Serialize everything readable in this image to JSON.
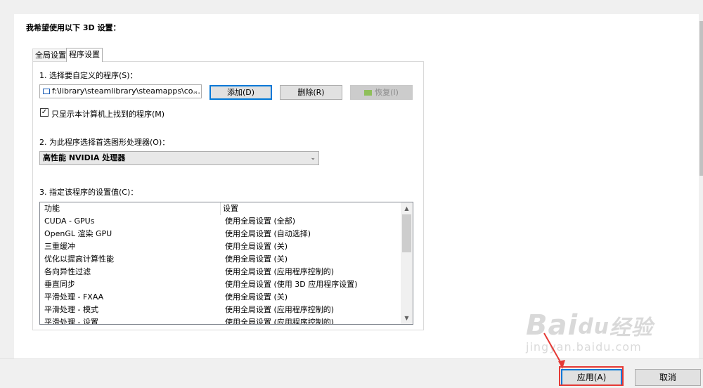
{
  "heading": "我希望使用以下 3D 设置：",
  "tabs": [
    {
      "label": "全局设置"
    },
    {
      "label": "程序设置"
    }
  ],
  "section1": {
    "label": "1. 选择要自定义的程序(S)：",
    "program_value": "f:\\library\\steamlibrary\\steamapps\\co...",
    "add_label": "添加(D)",
    "delete_label": "删除(R)",
    "restore_label": "恢复(I)",
    "checkbox_label": "只显示本计算机上找到的程序(M)",
    "checkbox_checked": true
  },
  "section2": {
    "label": "2. 为此程序选择首选图形处理器(O)：",
    "gpu_value": "高性能 NVIDIA 处理器"
  },
  "section3": {
    "label": "3. 指定该程序的设置值(C)：",
    "col_feature": "功能",
    "col_setting": "设置",
    "rows": [
      {
        "feature": "CUDA - GPUs",
        "setting": "使用全局设置 (全部)"
      },
      {
        "feature": "OpenGL 渲染 GPU",
        "setting": "使用全局设置 (自动选择)"
      },
      {
        "feature": "三重缓冲",
        "setting": "使用全局设置 (关)"
      },
      {
        "feature": "优化以提高计算性能",
        "setting": "使用全局设置 (关)"
      },
      {
        "feature": "各向异性过滤",
        "setting": "使用全局设置 (应用程序控制的)"
      },
      {
        "feature": "垂直同步",
        "setting": "使用全局设置 (使用 3D 应用程序设置)"
      },
      {
        "feature": "平滑处理 - FXAA",
        "setting": "使用全局设置 (关)"
      },
      {
        "feature": "平滑处理 - 模式",
        "setting": "使用全局设置 (应用程序控制的)"
      },
      {
        "feature": "平滑处理 - 设置",
        "setting": "使用全局设置 (应用程序控制的)"
      }
    ]
  },
  "footer": {
    "apply_label": "应用(A)",
    "cancel_label": "取消"
  },
  "watermark": {
    "brand": "Bai",
    "brand2": "经验",
    "url": "jingyan.baidu.com"
  },
  "colors": {
    "highlight": "#e53935",
    "focus": "#0078d7"
  }
}
